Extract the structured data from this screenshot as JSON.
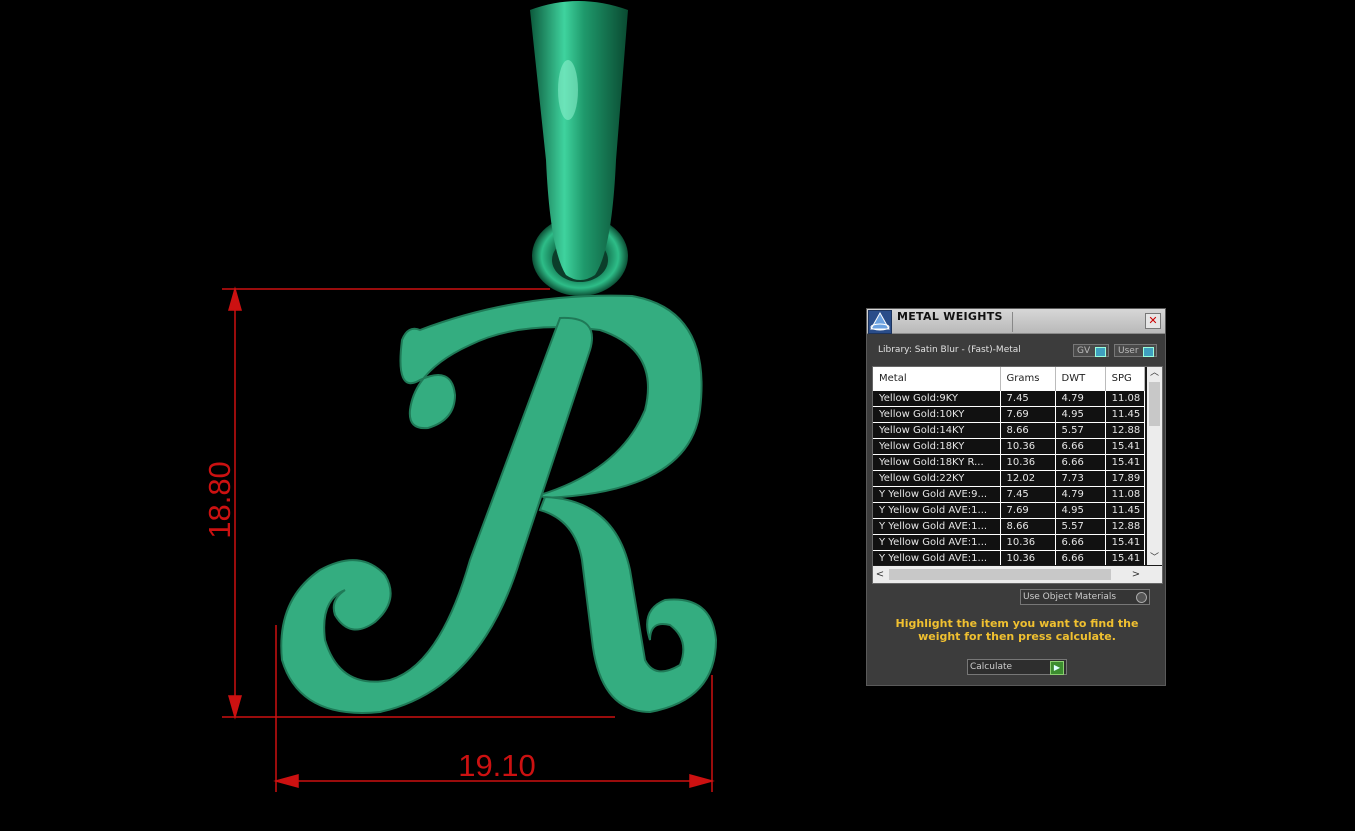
{
  "viewport": {
    "height_dim": "18.80",
    "width_dim": "19.10",
    "dim_color": "#cc1111",
    "model_color": "#34ad80"
  },
  "panel": {
    "title": "METAL WEIGHTS",
    "close_glyph": "✕",
    "library_label": "Library: Satin Blur - (Fast)-Metal",
    "gv_label": "GV",
    "user_label": "User",
    "headers": [
      "Metal",
      "Grams",
      "DWT",
      "SPG"
    ],
    "rows": [
      [
        "Yellow Gold:9KY",
        "7.45",
        "4.79",
        "11.08"
      ],
      [
        "Yellow Gold:10KY",
        "7.69",
        "4.95",
        "11.45"
      ],
      [
        "Yellow Gold:14KY",
        "8.66",
        "5.57",
        "12.88"
      ],
      [
        "Yellow Gold:18KY",
        "10.36",
        "6.66",
        "15.41"
      ],
      [
        "Yellow Gold:18KY R...",
        "10.36",
        "6.66",
        "15.41"
      ],
      [
        "Yellow Gold:22KY",
        "12.02",
        "7.73",
        "17.89"
      ],
      [
        "Y Yellow Gold AVE:9...",
        "7.45",
        "4.79",
        "11.08"
      ],
      [
        "Y Yellow Gold AVE:1...",
        "7.69",
        "4.95",
        "11.45"
      ],
      [
        "Y Yellow Gold AVE:1...",
        "8.66",
        "5.57",
        "12.88"
      ],
      [
        "Y Yellow Gold AVE:1...",
        "10.36",
        "6.66",
        "15.41"
      ],
      [
        "Y Yellow Gold AVE:1...",
        "10.36",
        "6.66",
        "15.41"
      ]
    ],
    "use_object_materials": "Use Object Materials",
    "hint": "Highlight the item you want to find the weight for then press calculate.",
    "calculate_label": "Calculate"
  }
}
